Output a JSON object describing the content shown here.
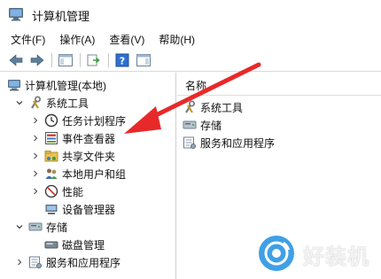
{
  "window": {
    "title": "计算机管理"
  },
  "menu": {
    "file": "文件(F)",
    "action": "操作(A)",
    "view": "查看(V)",
    "help": "帮助(H)"
  },
  "tree": {
    "root": "计算机管理(本地)",
    "system_tools": "系统工具",
    "task_scheduler": "任务计划程序",
    "event_viewer": "事件查看器",
    "shared_folders": "共享文件夹",
    "local_users": "本地用户和组",
    "performance": "性能",
    "device_manager": "设备管理器",
    "storage": "存储",
    "disk_management": "磁盘管理",
    "services_apps": "服务和应用程序"
  },
  "list": {
    "header_name": "名称",
    "items": [
      "系统工具",
      "存储",
      "服务和应用程序"
    ]
  },
  "watermark": {
    "text": "好装机"
  },
  "colors": {
    "annotation_arrow": "#e8292a",
    "toolbar_blue": "#2f6fd1",
    "watermark_blue": "#1f8fe0"
  }
}
